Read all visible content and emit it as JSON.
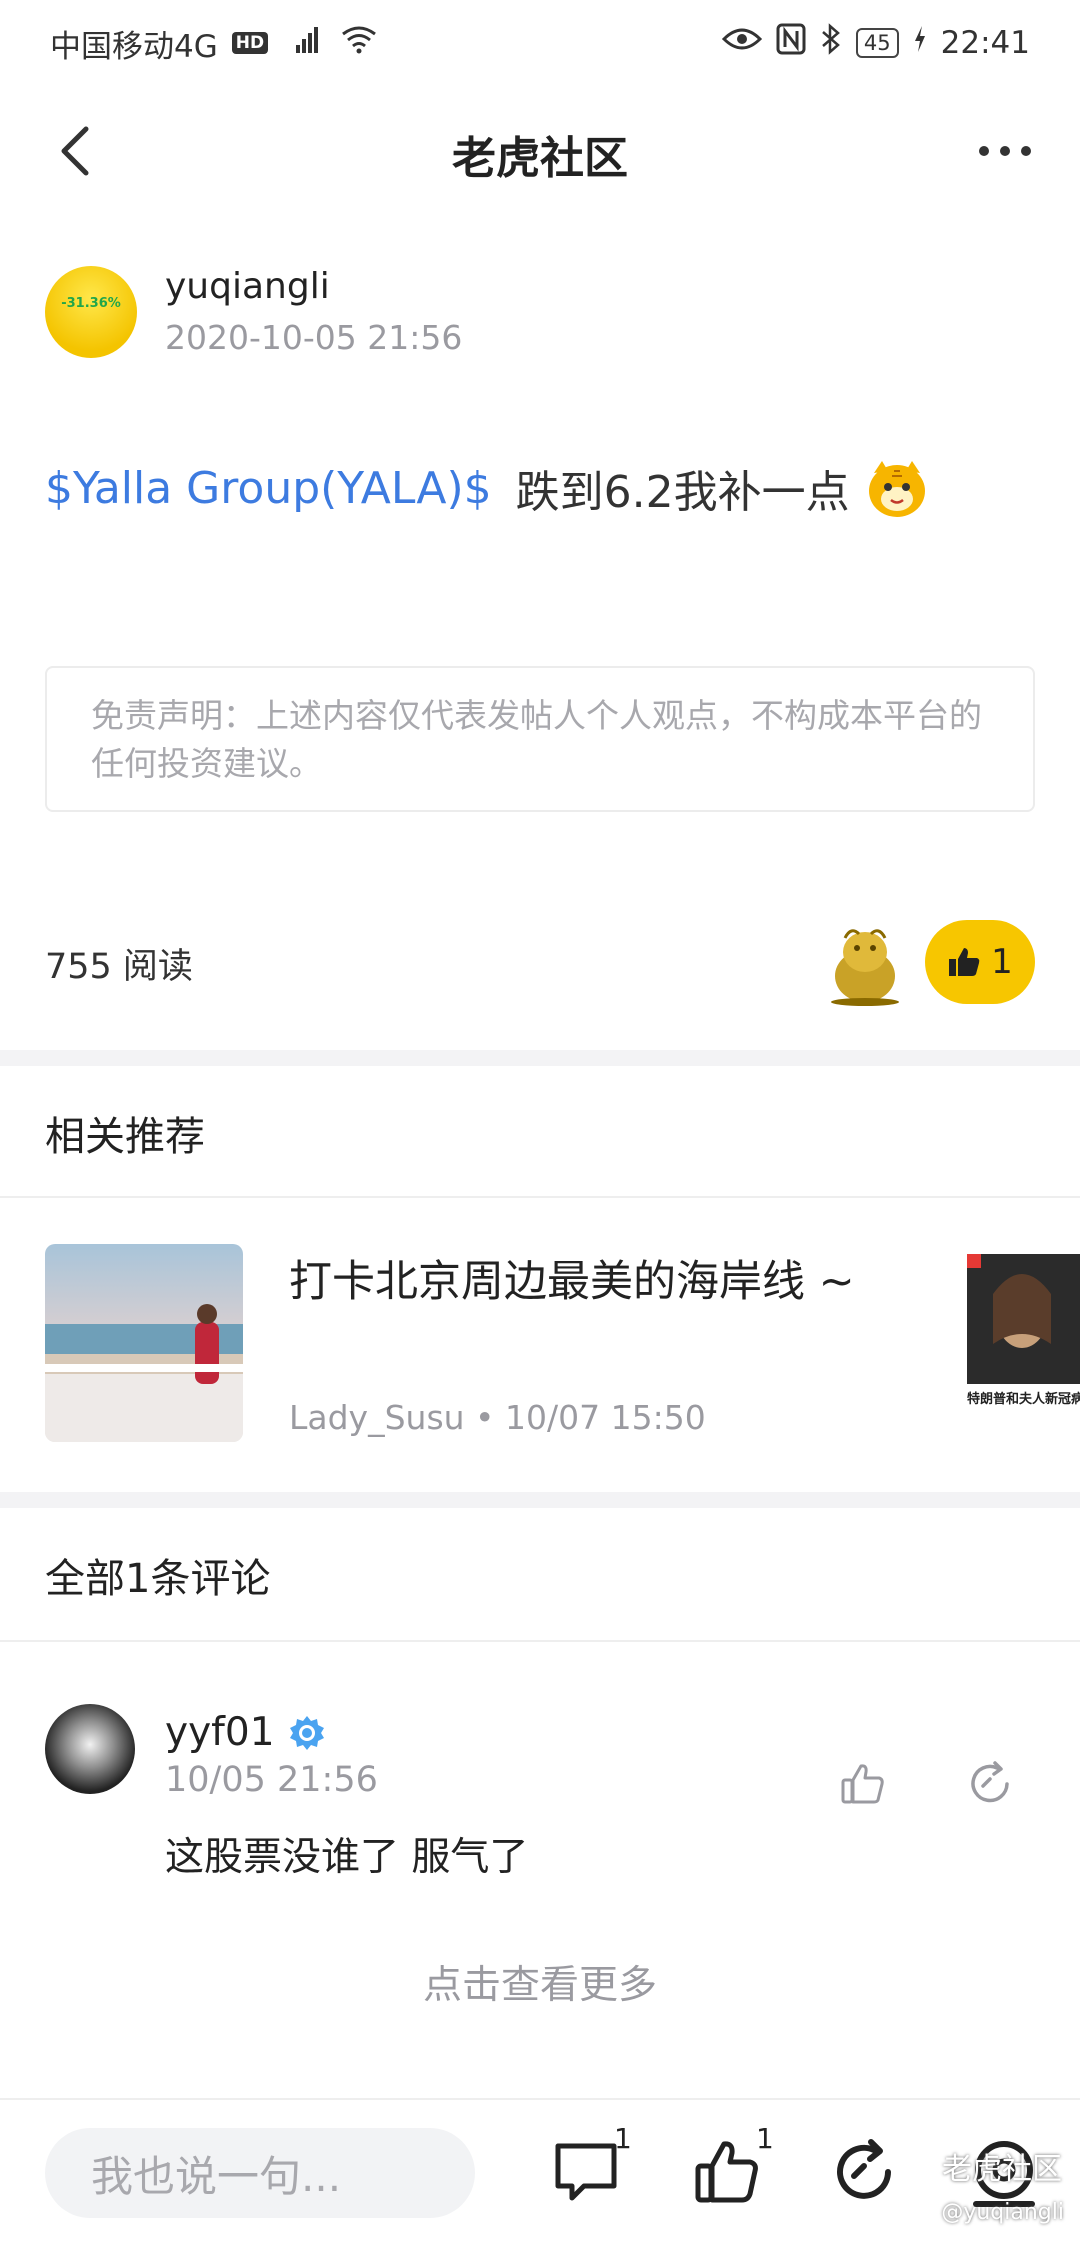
{
  "status_bar": {
    "carrier": "中国移动4G",
    "hd": "HD",
    "network": "4G",
    "battery": "45",
    "time": "22:41"
  },
  "nav": {
    "title": "老虎社区"
  },
  "post": {
    "author": "yuqiangli",
    "time": "2020-10-05 21:56",
    "avatar_label": "-31.36%",
    "stock_tag": "$Yalla Group(YALA)$",
    "text": "跌到6.2我补一点",
    "disclaimer": "免责声明：上述内容仅代表发帖人个人观点，不构成本平台的任何投资建议。",
    "read_count": "755 阅读",
    "like_count": "1"
  },
  "recommend": {
    "section_title": "相关推荐",
    "item": {
      "title": "打卡北京周边最美的海岸线 ~",
      "author": "Lady_Susu",
      "time": "10/07 15:50",
      "meta": "Lady_Susu • 10/07 15:50"
    },
    "next_card_caption": "特朗普和夫人新冠病毒"
  },
  "comments": {
    "section_title": "全部1条评论",
    "items": [
      {
        "user": "yyf01",
        "time": "10/05 21:56",
        "text": "这股票没谁了 服气了"
      }
    ],
    "load_more": "点击查看更多"
  },
  "bottom_bar": {
    "input_placeholder": "我也说一句...",
    "comment_badge": "1",
    "like_badge": "1",
    "watermark": "老虎社区",
    "watermark_user": "@yuqiangli"
  },
  "colors": {
    "accent_yellow": "#f7c600",
    "link_blue": "#3d7be0",
    "muted_gray": "#9a9aa0"
  }
}
